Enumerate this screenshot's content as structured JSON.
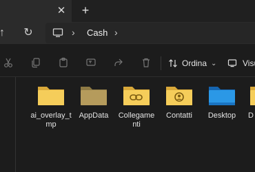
{
  "tabbar": {
    "close_glyph": "✕",
    "new_tab_glyph": "+"
  },
  "navigation": {
    "up_glyph": "↑",
    "refresh_glyph": "↻",
    "chevron_glyph": "›"
  },
  "breadcrumb": {
    "items": [
      "Cash"
    ]
  },
  "commandbar": {
    "sort_label": "Ordina",
    "sort_chevron": "⌄",
    "view_label": "Visu"
  },
  "files": [
    {
      "label": "ai_overlay_t mp",
      "icon": "folder-icon",
      "color": "#f2c94c"
    },
    {
      "label": "AppData",
      "icon": "folder-icon",
      "color": "#b8a060"
    },
    {
      "label": "Collegame nti",
      "icon": "links-folder-icon",
      "color": "#f2c94c"
    },
    {
      "label": "Contatti",
      "icon": "contacts-folder-icon",
      "color": "#f2c94c"
    },
    {
      "label": "Desktop",
      "icon": "desktop-folder-icon",
      "color": "#1e90e0"
    },
    {
      "label": "D",
      "icon": "folder-icon",
      "color": "#f2c94c"
    }
  ]
}
